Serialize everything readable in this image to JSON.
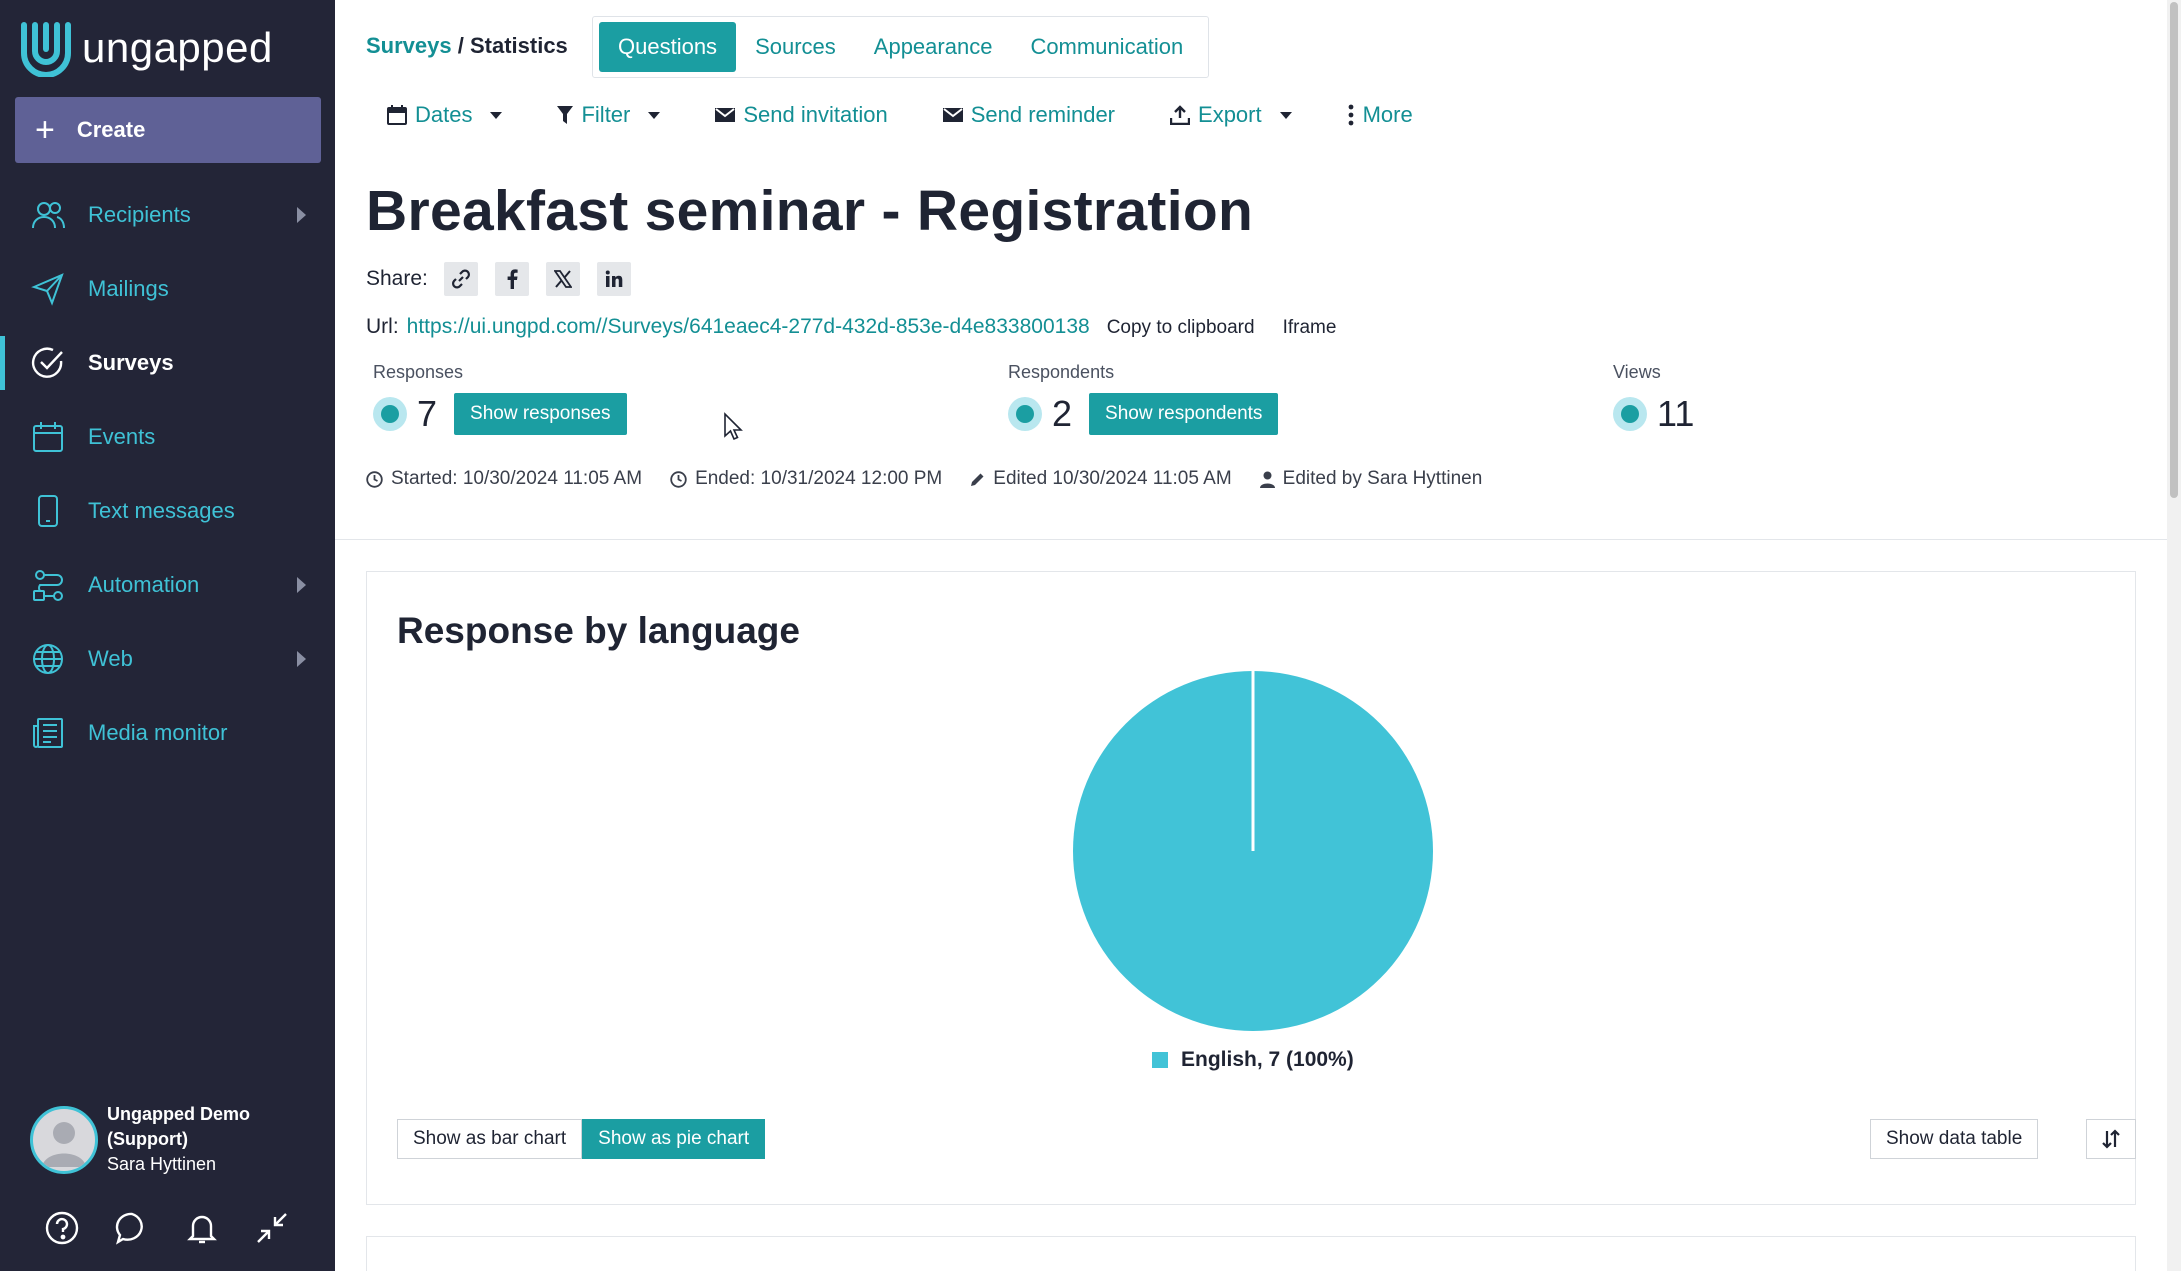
{
  "app": {
    "logo_text": "ungapped"
  },
  "sidebar": {
    "create_label": "Create",
    "items": [
      {
        "label": "Recipients",
        "icon": "people-icon",
        "has_submenu": true
      },
      {
        "label": "Mailings",
        "icon": "paper-plane-icon",
        "has_submenu": false
      },
      {
        "label": "Surveys",
        "icon": "check-circle-icon",
        "has_submenu": false,
        "active": true
      },
      {
        "label": "Events",
        "icon": "calendar-icon",
        "has_submenu": false
      },
      {
        "label": "Text messages",
        "icon": "phone-icon",
        "has_submenu": false
      },
      {
        "label": "Automation",
        "icon": "workflow-icon",
        "has_submenu": true
      },
      {
        "label": "Web",
        "icon": "globe-icon",
        "has_submenu": true
      },
      {
        "label": "Media monitor",
        "icon": "newspaper-icon",
        "has_submenu": false
      }
    ],
    "user": {
      "line1": "Ungapped Demo",
      "line2": "(Support)",
      "line3": "Sara Hyttinen"
    },
    "bottom_icons": [
      "help-icon",
      "chat-icon",
      "bell-icon",
      "collapse-icon"
    ]
  },
  "header": {
    "breadcrumb": {
      "parent": "Surveys",
      "separator": " / ",
      "current": "Statistics"
    },
    "tabs": [
      "Questions",
      "Sources",
      "Appearance",
      "Communication"
    ],
    "active_tab": "Questions"
  },
  "toolbar": {
    "dates": "Dates",
    "filter": "Filter",
    "send_invitation": "Send invitation",
    "send_reminder": "Send reminder",
    "export": "Export",
    "more": "More"
  },
  "survey": {
    "title": "Breakfast seminar - Registration",
    "share_label": "Share:",
    "share_icons": [
      "link-icon",
      "facebook-icon",
      "x-icon",
      "linkedin-icon"
    ],
    "url_label": "Url:",
    "url": "https://ui.ungpd.com//Surveys/641eaec4-277d-432d-853e-d4e833800138",
    "copy_label": "Copy to clipboard",
    "iframe_label": "Iframe"
  },
  "stats": {
    "responses": {
      "label": "Responses",
      "value": "7",
      "button": "Show responses"
    },
    "respondents": {
      "label": "Respondents",
      "value": "2",
      "button": "Show respondents"
    },
    "views": {
      "label": "Views",
      "value": "11"
    }
  },
  "meta": {
    "started": "Started: 10/30/2024 11:05 AM",
    "ended": "Ended: 10/31/2024 12:00 PM",
    "edited": "Edited 10/30/2024 11:05 AM",
    "edited_by": "Edited by Sara Hyttinen"
  },
  "card": {
    "title": "Response by language",
    "bar_btn": "Show as bar chart",
    "pie_btn": "Show as pie chart",
    "data_table_btn": "Show data table"
  },
  "colors": {
    "sidebar_bg": "#232537",
    "accent": "#1b9ea2",
    "link": "#138f94",
    "pie": "#41c3d7",
    "create_bg": "#5f6196"
  },
  "chart_data": {
    "type": "pie",
    "title": "Response by language",
    "categories": [
      "English"
    ],
    "values": [
      7
    ],
    "percentages": [
      100
    ],
    "legend": [
      "English, 7 (100%)"
    ],
    "legend_position": "bottom"
  }
}
